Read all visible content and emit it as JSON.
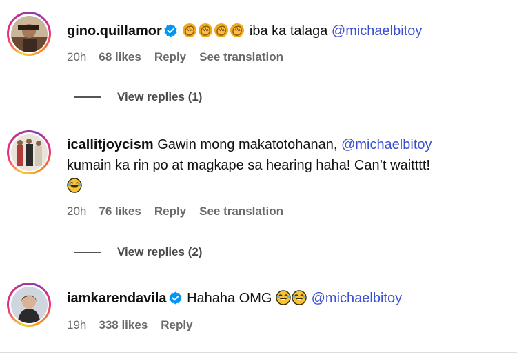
{
  "comments": [
    {
      "username": "gino.quillamor",
      "verified": true,
      "text_parts": [
        "iba ka talaga",
        "@michaelbitoy"
      ],
      "emojis": [
        "clap-emoji",
        "clap-emoji",
        "clap-emoji",
        "clap-emoji"
      ],
      "time": "20h",
      "likes": "68 likes",
      "reply": "Reply",
      "translate": "See translation",
      "view_replies": "View replies (1)"
    },
    {
      "username": "icallitjoycism",
      "verified": false,
      "text_line1": "Gawin mong makatotohanan,",
      "mention": "@michaelbitoy",
      "text_line2": "kumain ka rin po at magkape sa hearing haha! Can’t waitttt!",
      "emojis": [
        "laughing-emoji"
      ],
      "time": "20h",
      "likes": "76 likes",
      "reply": "Reply",
      "translate": "See translation",
      "view_replies": "View replies (2)"
    },
    {
      "username": "iamkarendavila",
      "verified": true,
      "text": "Hahaha OMG",
      "emojis": [
        "laughing-emoji",
        "laughing-emoji"
      ],
      "mention": "@michaelbitoy",
      "time": "19h",
      "likes": "338 likes",
      "reply": "Reply"
    }
  ],
  "colors": {
    "mention": "#3a4fd1",
    "verified": "#0095f6",
    "meta": "#6a6a6a"
  }
}
